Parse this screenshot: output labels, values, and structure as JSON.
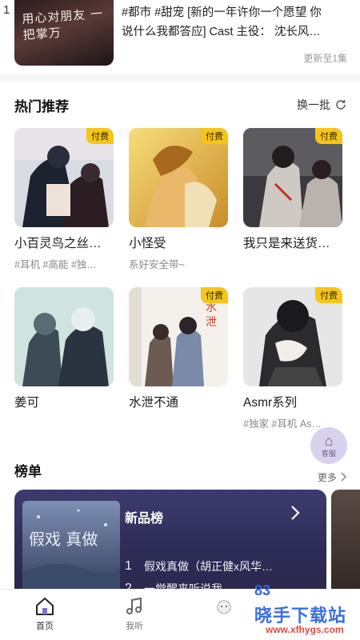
{
  "top": {
    "index": "1",
    "cover_text": "用心对朋友 一把掌万",
    "desc_line1": "#都市 #甜宠 [新的一年许你一个愿望 你",
    "desc_line2": "说什么我都答应] Cast 主役： 沈长风…",
    "update": "更新至1集"
  },
  "hot": {
    "title": "热门推荐",
    "action": "换一批",
    "paid_label": "付费",
    "cards": [
      {
        "title": "小百灵鸟之丝…",
        "tags": "#耳机 #高能 #独…",
        "paid": true
      },
      {
        "title": "小怪受",
        "tags": "系好安全带~",
        "paid": true
      },
      {
        "title": "我只是来送货…",
        "tags": "",
        "paid": true
      },
      {
        "title": "姜可",
        "tags": "",
        "paid": false
      },
      {
        "title": "水泄不通",
        "tags": "",
        "paid": true
      },
      {
        "title": "Asmr系列",
        "tags": "#独家 #耳机 As…",
        "paid": true
      }
    ]
  },
  "float_widget": {
    "label": "客服"
  },
  "ranking": {
    "title": "榜单",
    "more": "更多",
    "banner_name": "新品榜",
    "cover_text": "假戏 真做",
    "items": [
      {
        "n": "1",
        "t": "假戏真做（胡正健x风华…"
      },
      {
        "n": "2",
        "t": "一觉醒来听说我"
      }
    ]
  },
  "tabs": [
    {
      "label": "首页"
    },
    {
      "label": "我听"
    },
    {
      "label": ""
    },
    {
      "label": ""
    }
  ],
  "watermark": {
    "brand": "晓手下载站",
    "url": "www.xfhygs.com",
    "logo": "83"
  }
}
